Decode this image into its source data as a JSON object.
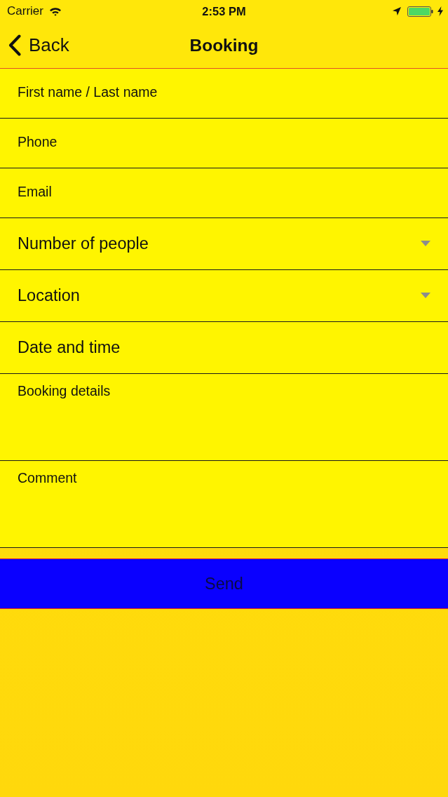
{
  "status_bar": {
    "carrier": "Carrier",
    "time": "2:53 PM"
  },
  "nav_bar": {
    "back": "Back",
    "title": "Booking"
  },
  "form": {
    "fields": [
      {
        "kind": "text",
        "placeholder": "First name / Last name"
      },
      {
        "kind": "text",
        "placeholder": "Phone"
      },
      {
        "kind": "text",
        "placeholder": "Email"
      },
      {
        "kind": "select",
        "placeholder": "Number of people"
      },
      {
        "kind": "select",
        "placeholder": "Location"
      },
      {
        "kind": "picker",
        "placeholder": "Date and time"
      },
      {
        "kind": "textarea",
        "placeholder": "Booking details"
      },
      {
        "kind": "textarea",
        "placeholder": "Comment"
      }
    ]
  },
  "send_button": {
    "label": "Send"
  }
}
